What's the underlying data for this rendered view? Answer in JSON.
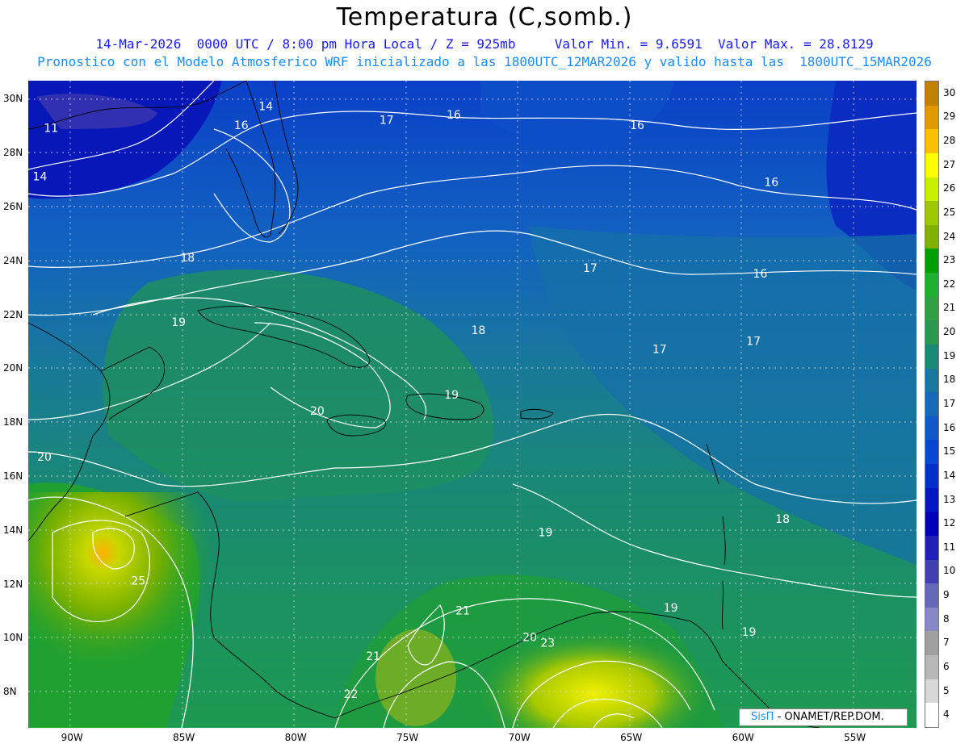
{
  "title": "Temperatura (C,somb.)",
  "subtitle_line1": "14-Mar-2026  0000 UTC / 8:00 pm Hora Local / Z = 925mb     Valor Min. = 9.6591  Valor Max. = 28.8129",
  "subtitle_line2": "Pronostico con el Modelo Atmosferico WRF inicializado a las 1800UTC_12MAR2026 y valido hasta las  1800UTC_15MAR2026",
  "credit_sis": "SisΠ",
  "credit_rest": "- ONAMET/REP.DOM.",
  "x_axis_labels": [
    "90W",
    "85W",
    "80W",
    "75W",
    "70W",
    "65W",
    "60W",
    "55W"
  ],
  "y_axis_labels": [
    "30N",
    "28N",
    "26N",
    "24N",
    "22N",
    "20N",
    "18N",
    "16N",
    "14N",
    "12N",
    "10N",
    "8N"
  ],
  "colorbar": {
    "levels": [
      "30",
      "29",
      "28",
      "27",
      "26",
      "25",
      "24",
      "23",
      "22",
      "21",
      "20",
      "19",
      "18",
      "17",
      "16",
      "15",
      "14",
      "13",
      "12",
      "11",
      "10",
      "9",
      "8",
      "7",
      "6",
      "5",
      "4"
    ],
    "colors": [
      "#c08000",
      "#e09a00",
      "#ffc000",
      "#ffff00",
      "#c8f000",
      "#a0c800",
      "#80b000",
      "#00a000",
      "#20b030",
      "#30a040",
      "#2a9850",
      "#1a8a78",
      "#1878a0",
      "#1868b8",
      "#1058c8",
      "#0848d0",
      "#0030c8",
      "#0018c0",
      "#0000b8",
      "#2020b8",
      "#4040b0",
      "#6868b8",
      "#8888c8",
      "#a0a0a0",
      "#b8b8b8",
      "#d8d8d8",
      "#ffffff"
    ]
  },
  "contour_labels": [
    {
      "text": "11",
      "lon": -91.2,
      "lat": 28.8
    },
    {
      "text": "14",
      "lon": -91.7,
      "lat": 27.0
    },
    {
      "text": "14",
      "lon": -81.6,
      "lat": 29.6
    },
    {
      "text": "16",
      "lon": -82.7,
      "lat": 28.9
    },
    {
      "text": "17",
      "lon": -76.2,
      "lat": 29.1
    },
    {
      "text": "16",
      "lon": -73.2,
      "lat": 29.3
    },
    {
      "text": "16",
      "lon": -65.0,
      "lat": 28.9
    },
    {
      "text": "16",
      "lon": -59.0,
      "lat": 26.8
    },
    {
      "text": "18",
      "lon": -85.1,
      "lat": 24.0
    },
    {
      "text": "17",
      "lon": -67.1,
      "lat": 23.6
    },
    {
      "text": "16",
      "lon": -59.5,
      "lat": 23.4
    },
    {
      "text": "19",
      "lon": -85.5,
      "lat": 21.6
    },
    {
      "text": "18",
      "lon": -72.1,
      "lat": 21.3
    },
    {
      "text": "17",
      "lon": -64.0,
      "lat": 20.6
    },
    {
      "text": "17",
      "lon": -59.8,
      "lat": 20.9
    },
    {
      "text": "19",
      "lon": -73.3,
      "lat": 18.9
    },
    {
      "text": "20",
      "lon": -79.3,
      "lat": 18.3
    },
    {
      "text": "20",
      "lon": -91.5,
      "lat": 16.6
    },
    {
      "text": "18",
      "lon": -58.5,
      "lat": 14.3
    },
    {
      "text": "19",
      "lon": -69.1,
      "lat": 13.8
    },
    {
      "text": "25",
      "lon": -87.3,
      "lat": 12.0
    },
    {
      "text": "21",
      "lon": -72.8,
      "lat": 10.9
    },
    {
      "text": "19",
      "lon": -63.5,
      "lat": 11.0
    },
    {
      "text": "19",
      "lon": -60.0,
      "lat": 10.1
    },
    {
      "text": "20",
      "lon": -69.8,
      "lat": 9.9
    },
    {
      "text": "23",
      "lon": -69.0,
      "lat": 9.7
    },
    {
      "text": "21",
      "lon": -76.8,
      "lat": 9.2
    },
    {
      "text": "22",
      "lon": -77.8,
      "lat": 7.8
    }
  ]
}
